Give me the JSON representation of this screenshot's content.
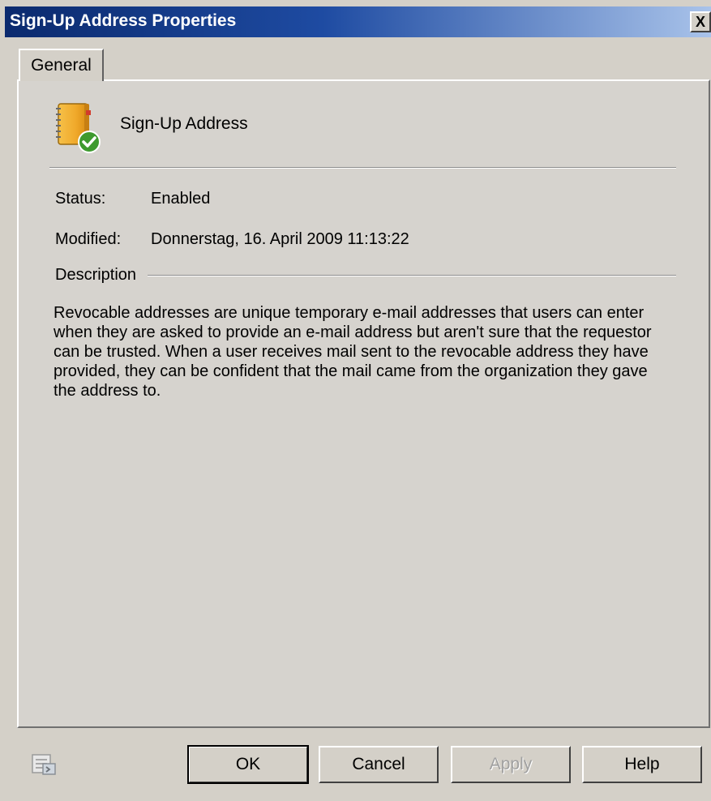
{
  "window": {
    "title": "Sign-Up Address Properties",
    "close_symbol": "X"
  },
  "tabs": [
    {
      "label": "General",
      "selected": true
    }
  ],
  "general": {
    "icon": "address-book-check-icon",
    "name": "Sign-Up Address",
    "status_label": "Status:",
    "status_value": "Enabled",
    "modified_label": "Modified:",
    "modified_value": "Donnerstag, 16. April 2009 11:13:22",
    "description_label": "Description",
    "description_text": "Revocable addresses are unique temporary e-mail addresses that users can enter when they are asked to provide an e-mail address but aren't sure that the requestor can be trusted. When a user receives mail sent to the revocable address they have provided, they can be confident that the mail came from the organization they gave the address to."
  },
  "footer": {
    "icon": "properties-icon",
    "ok_label": "OK",
    "cancel_label": "Cancel",
    "apply_label": "Apply",
    "apply_enabled": false,
    "help_label": "Help"
  },
  "colors": {
    "titlebar_start": "#0b2a6e",
    "titlebar_end": "#a9c3ea",
    "dialog_background": "#d6d3ce"
  }
}
